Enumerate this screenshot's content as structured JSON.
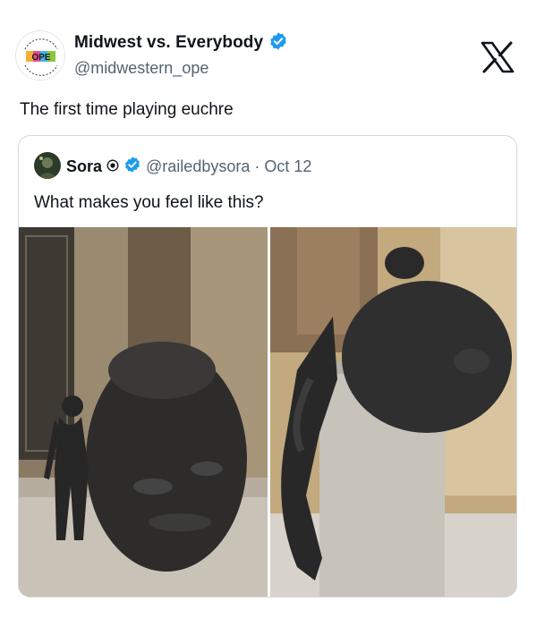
{
  "tweet": {
    "author": {
      "display_name": "Midwest vs. Everybody",
      "handle": "@midwestern_ope",
      "verified": true,
      "avatar_text": "OPE"
    },
    "text": "The first time playing euchre",
    "platform_icon": "x-logo-icon"
  },
  "quote": {
    "author": {
      "display_name": "Sora",
      "handle": "@railedbysora",
      "verified": true
    },
    "separator": "·",
    "date": "Oct 12",
    "text": "What makes you feel like this?",
    "media": [
      {
        "name": "sculpture-photo-left"
      },
      {
        "name": "sculpture-photo-right"
      }
    ]
  },
  "colors": {
    "verified_badge": "#1d9bf0",
    "secondary_text": "#536471",
    "border": "#cfd9de"
  }
}
